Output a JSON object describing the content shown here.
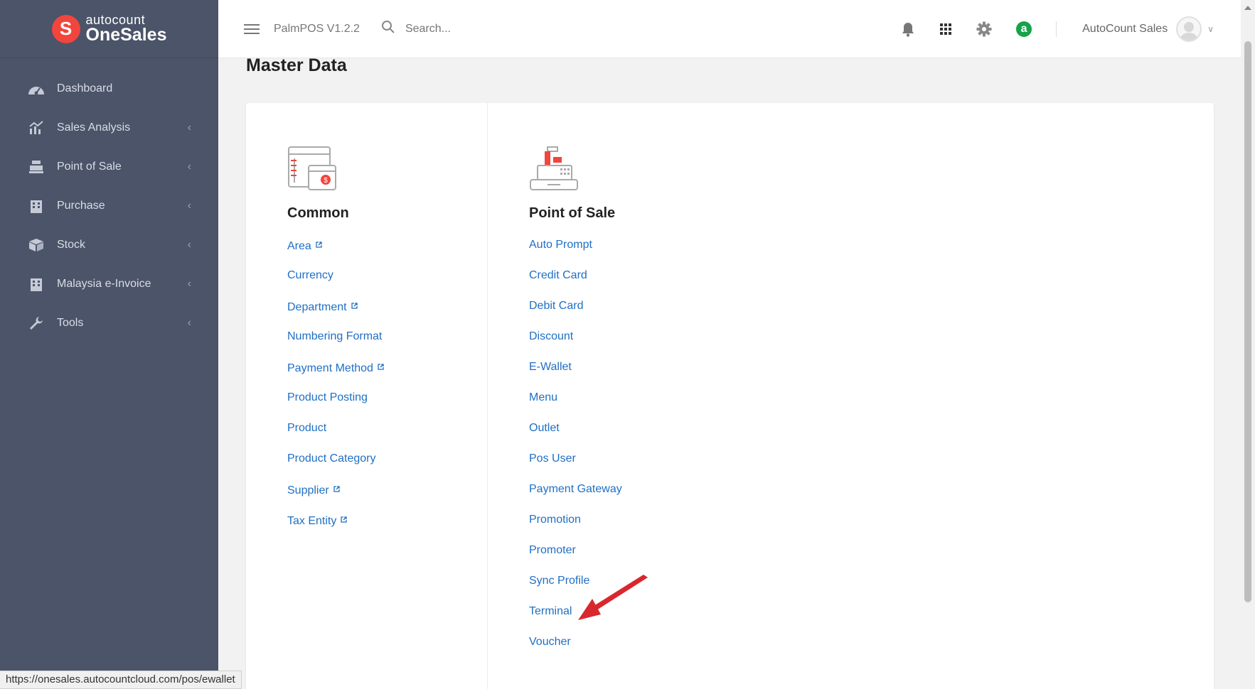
{
  "brand": {
    "logo_letter": "S",
    "top": "autocount",
    "bottom": "OneSales"
  },
  "sidebar": {
    "items": [
      {
        "label": "Dashboard",
        "icon": "dashboard-icon",
        "chevron": ""
      },
      {
        "label": "Sales Analysis",
        "icon": "chart-icon",
        "chevron": "‹"
      },
      {
        "label": "Point of Sale",
        "icon": "cash-register-icon",
        "chevron": "‹"
      },
      {
        "label": "Purchase",
        "icon": "building-icon",
        "chevron": "‹"
      },
      {
        "label": "Stock",
        "icon": "box-icon",
        "chevron": "‹"
      },
      {
        "label": "Malaysia e-Invoice",
        "icon": "building-icon",
        "chevron": "‹"
      },
      {
        "label": "Tools",
        "icon": "wrench-icon",
        "chevron": "‹"
      }
    ]
  },
  "header": {
    "app_version": "PalmPOS V1.2.2",
    "search_placeholder": "Search...",
    "badge_letter": "a",
    "user_name": "AutoCount Sales"
  },
  "page": {
    "title": "Master Data"
  },
  "common": {
    "title": "Common",
    "links": [
      {
        "label": "Area",
        "external": true
      },
      {
        "label": "Currency",
        "external": false
      },
      {
        "label": "Department",
        "external": true
      },
      {
        "label": "Numbering Format",
        "external": false
      },
      {
        "label": "Payment Method",
        "external": true
      },
      {
        "label": "Product Posting",
        "external": false
      },
      {
        "label": "Product",
        "external": false
      },
      {
        "label": "Product Category",
        "external": false
      },
      {
        "label": "Supplier",
        "external": true
      },
      {
        "label": "Tax Entity",
        "external": true
      }
    ]
  },
  "pos": {
    "title": "Point of Sale",
    "links": [
      "Auto Prompt",
      "Credit Card",
      "Debit Card",
      "Discount",
      "E-Wallet",
      "Menu",
      "Outlet",
      "Pos User",
      "Payment Gateway",
      "Promotion",
      "Promoter",
      "Sync Profile",
      "Terminal",
      "Voucher"
    ]
  },
  "status_url": "https://onesales.autocountcloud.com/pos/ewallet",
  "colors": {
    "sidebar": "#4b5468",
    "link": "#1f6fc4",
    "brand_red": "#f1453d",
    "badge_green": "#17a34a"
  }
}
